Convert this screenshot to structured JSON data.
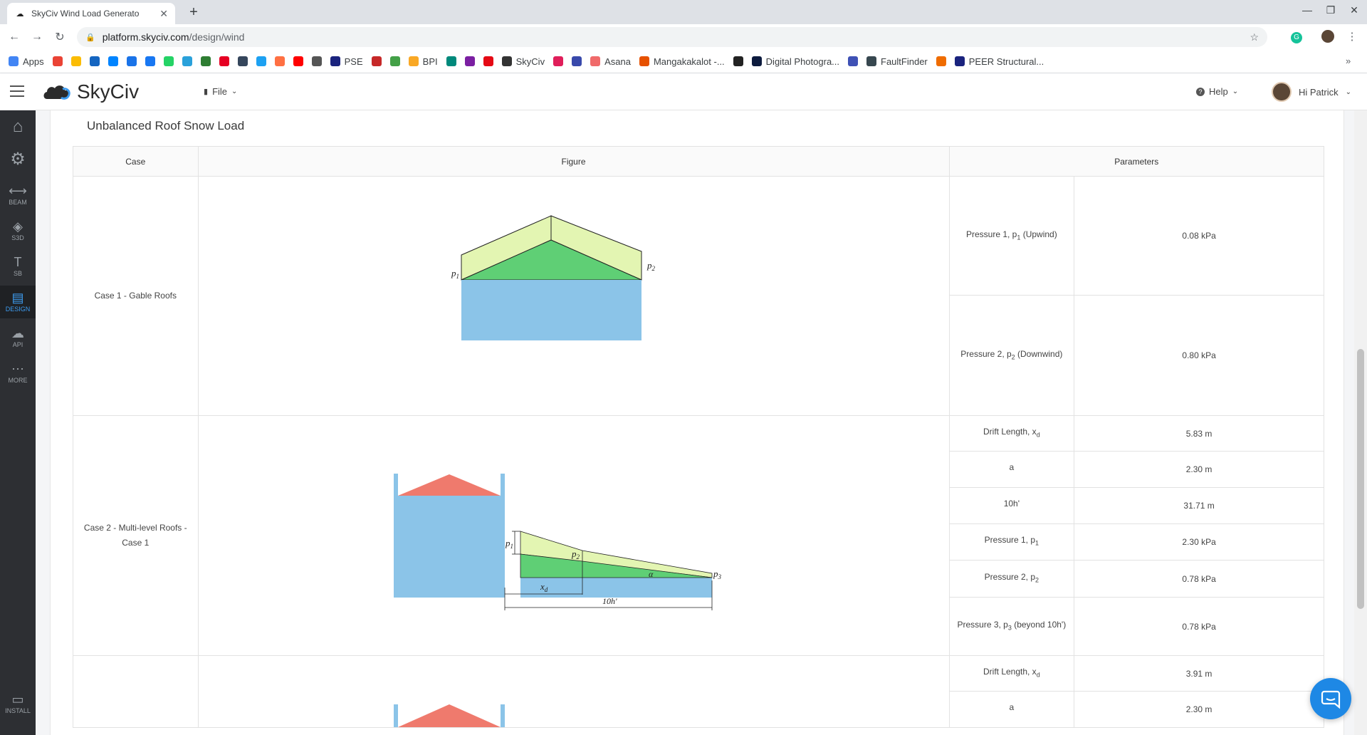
{
  "browser": {
    "tab_title": "SkyCiv Wind Load Generato",
    "url_host": "platform.skyciv.com",
    "url_path": "/design/wind",
    "bookmarks": [
      {
        "label": "Apps",
        "icon": "apps-grid-icon",
        "color": "#4285f4"
      },
      {
        "label": "",
        "icon": "gmail-icon",
        "color": "#ea4335"
      },
      {
        "label": "",
        "icon": "drive-icon",
        "color": "#fbbc04"
      },
      {
        "label": "",
        "icon": "mail-icon",
        "color": "#1565c0"
      },
      {
        "label": "",
        "icon": "messenger-icon",
        "color": "#0084ff"
      },
      {
        "label": "",
        "icon": "chat-icon",
        "color": "#1a73e8"
      },
      {
        "label": "",
        "icon": "facebook-icon",
        "color": "#1877f2"
      },
      {
        "label": "",
        "icon": "whatsapp-icon",
        "color": "#25d366"
      },
      {
        "label": "",
        "icon": "telegram-icon",
        "color": "#2aa1da"
      },
      {
        "label": "",
        "icon": "bookmark-icon",
        "color": "#2e7d32"
      },
      {
        "label": "",
        "icon": "pinterest-icon",
        "color": "#e60023"
      },
      {
        "label": "",
        "icon": "tumblr-icon",
        "color": "#35465c"
      },
      {
        "label": "",
        "icon": "twitter-icon",
        "color": "#1da1f2"
      },
      {
        "label": "",
        "icon": "bookmark-icon",
        "color": "#ff7043"
      },
      {
        "label": "",
        "icon": "youtube-icon",
        "color": "#ff0000"
      },
      {
        "label": "",
        "icon": "bookmark-icon",
        "color": "#555555"
      },
      {
        "label": "PSE",
        "icon": "pse-icon",
        "color": "#1a237e"
      },
      {
        "label": "",
        "icon": "bookmark-icon",
        "color": "#c62828"
      },
      {
        "label": "",
        "icon": "bookmark-icon",
        "color": "#43a047"
      },
      {
        "label": "BPI",
        "icon": "bpi-icon",
        "color": "#f9a825"
      },
      {
        "label": "",
        "icon": "bookmark-icon",
        "color": "#00897b"
      },
      {
        "label": "",
        "icon": "bookmark-icon",
        "color": "#7b1fa2"
      },
      {
        "label": "",
        "icon": "netflix-icon",
        "color": "#e50914"
      },
      {
        "label": "SkyCiv",
        "icon": "skyciv-icon",
        "color": "#333333"
      },
      {
        "label": "",
        "icon": "slack-icon",
        "color": "#e01e5a"
      },
      {
        "label": "",
        "icon": "bookmark-icon",
        "color": "#3949ab"
      },
      {
        "label": "Asana",
        "icon": "asana-icon",
        "color": "#f06a6a"
      },
      {
        "label": "Mangakakalot -...",
        "icon": "bookmark-icon",
        "color": "#e65100"
      },
      {
        "label": "",
        "icon": "wix-icon",
        "color": "#222222"
      },
      {
        "label": "Digital Photogra...",
        "icon": "bookmark-icon",
        "color": "#0d1b3e"
      },
      {
        "label": "",
        "icon": "bookmark-icon",
        "color": "#3f51b5"
      },
      {
        "label": "FaultFinder",
        "icon": "faultfinder-icon",
        "color": "#37474f"
      },
      {
        "label": "",
        "icon": "bookmark-icon",
        "color": "#ef6c00"
      },
      {
        "label": "PEER Structural...",
        "icon": "info-icon",
        "color": "#1a237e"
      }
    ]
  },
  "app": {
    "logo_text": "SkyCiv",
    "file_menu": "File",
    "help_menu": "Help",
    "user_greeting": "Hi Patrick"
  },
  "sidebar": {
    "items": [
      {
        "label": "",
        "icon": "home-icon"
      },
      {
        "label": "",
        "icon": "gear-icon"
      },
      {
        "label": "BEAM",
        "icon": "beam-icon"
      },
      {
        "label": "S3D",
        "icon": "cube-icon"
      },
      {
        "label": "SB",
        "icon": "text-icon"
      },
      {
        "label": "DESIGN",
        "icon": "document-icon"
      },
      {
        "label": "API",
        "icon": "cloud-icon"
      },
      {
        "label": "MORE",
        "icon": "more-icon"
      }
    ],
    "install_label": "INSTALL"
  },
  "section": {
    "title": "Unbalanced Roof Snow Load",
    "headers": {
      "case": "Case",
      "figure": "Figure",
      "parameters": "Parameters"
    },
    "cases": [
      {
        "name": "Case 1 - Gable Roofs",
        "params": [
          {
            "label": "Pressure 1, p",
            "sub": "1",
            "suffix": " (Upwind)",
            "value": "0.08 kPa"
          },
          {
            "label": "Pressure 2, p",
            "sub": "2",
            "suffix": " (Downwind)",
            "value": "0.80 kPa"
          }
        ],
        "figure_labels": {
          "p1": "p",
          "p1_sub": "1",
          "p2": "p",
          "p2_sub": "2"
        }
      },
      {
        "name": "Case 2 - Multi-level Roofs - Case 1",
        "params": [
          {
            "label": "Drift Length, x",
            "sub": "d",
            "suffix": "",
            "value": "5.83 m"
          },
          {
            "label": "a",
            "sub": "",
            "suffix": "",
            "value": "2.30 m"
          },
          {
            "label": "10h'",
            "sub": "",
            "suffix": "",
            "value": "31.71 m"
          },
          {
            "label": "Pressure 1, p",
            "sub": "1",
            "suffix": "",
            "value": "2.30 kPa"
          },
          {
            "label": "Pressure 2, p",
            "sub": "2",
            "suffix": "",
            "value": "0.78 kPa"
          },
          {
            "label": "Pressure 3, p",
            "sub": "3",
            "suffix": " (beyond 10h')",
            "value": "0.78 kPa"
          }
        ],
        "figure_labels": {
          "p1": "p",
          "p1_sub": "1",
          "p2": "p",
          "p2_sub": "2",
          "p3": "p",
          "p3_sub": "3",
          "xd": "x",
          "xd_sub": "d",
          "alpha": "α",
          "tenh": "10h'"
        }
      },
      {
        "name": "",
        "params": [
          {
            "label": "Drift Length, x",
            "sub": "d",
            "suffix": "",
            "value": "3.91 m"
          },
          {
            "label": "a",
            "sub": "",
            "suffix": "",
            "value": "2.30 m"
          }
        ]
      }
    ]
  },
  "colors": {
    "snow_light": "#e3f5b2",
    "snow_dark": "#5fcf75",
    "building": "#8bc4e8",
    "roof_red": "#ef7a6d",
    "accent": "#3d9cf0",
    "chat": "#1e88e5"
  }
}
